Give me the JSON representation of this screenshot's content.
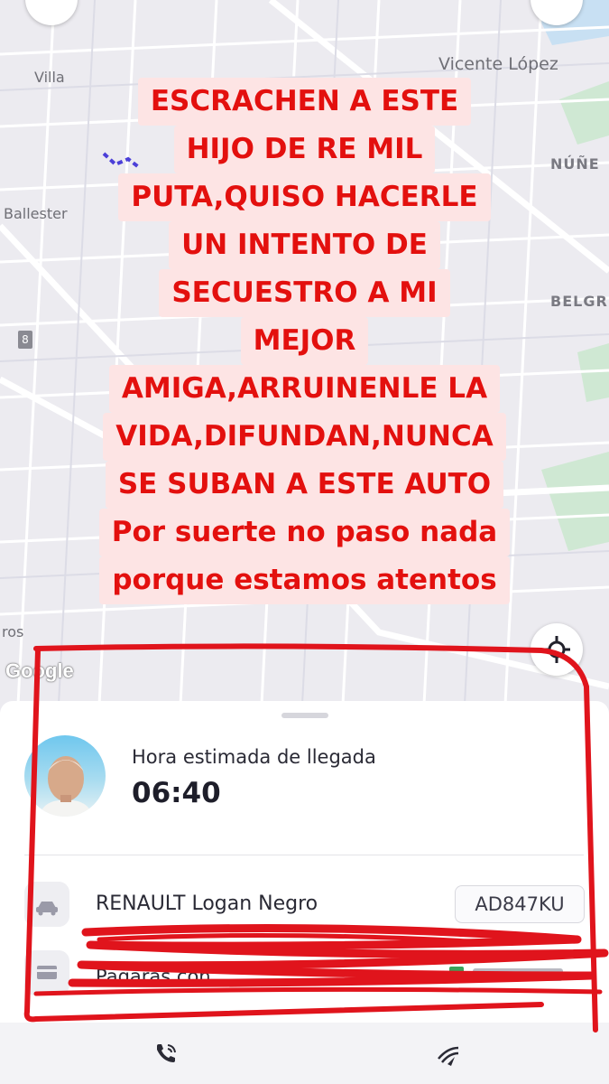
{
  "map": {
    "labels": {
      "villa": "Villa",
      "vicente_lopez": "Vicente López",
      "nunez": "NÚÑE",
      "ballester": "Ballester",
      "belgr": "BELGR",
      "route_badge": "8",
      "ros": "ros"
    },
    "attribution": "Google"
  },
  "overlay": {
    "lines": [
      "ESCRACHEN A ESTE",
      "HIJO DE RE MIL",
      "PUTA,QUISO HACERLE",
      "UN INTENTO DE",
      "SECUESTRO A MI",
      "MEJOR",
      "AMIGA,ARRUINENLE LA",
      "VIDA,DIFUNDAN,NUNCA",
      "SE SUBAN A ESTE AUTO",
      "Por suerte no paso nada",
      "porque estamos atentos"
    ],
    "text_color": "#e3100e",
    "bg_color": "#fde4e4"
  },
  "trip": {
    "eta_label": "Hora estimada de llegada",
    "eta_time": "06:40",
    "vehicle": "RENAULT Logan Negro",
    "plate": "AD847KU",
    "payment_label": "Pagarás con"
  },
  "icons": {
    "car": "car-icon",
    "card": "credit-card-icon",
    "call": "phone-call-icon",
    "share": "share-trip-icon",
    "recenter": "recenter-icon"
  },
  "annotation_color": "#e0141c"
}
